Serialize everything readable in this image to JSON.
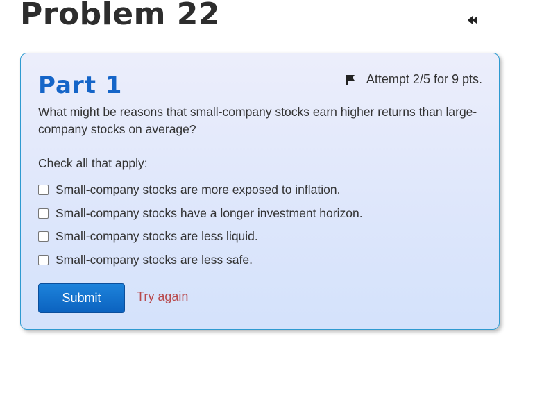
{
  "problem": {
    "title": "Problem 22",
    "collapse_icon": "double-chevron-left-icon"
  },
  "part": {
    "title": "Part 1",
    "attempt_label": "Attempt 2/5 for 9 pts.",
    "flag_icon": "flag-icon",
    "question": "What might be reasons that small-company stocks earn higher returns than large-company stocks on average?",
    "instruction": "Check all that apply:",
    "options": [
      {
        "label": "Small-company stocks are more exposed to inflation.",
        "checked": false
      },
      {
        "label": "Small-company stocks have a longer investment horizon.",
        "checked": false
      },
      {
        "label": "Small-company stocks are less liquid.",
        "checked": false
      },
      {
        "label": "Small-company stocks are less safe.",
        "checked": false
      }
    ],
    "submit_label": "Submit",
    "try_again_label": "Try again"
  },
  "colors": {
    "part_title": "#1565c8",
    "card_border": "#2e9ad0",
    "submit_button": "#0b62bf",
    "try_again": "#b8484b"
  }
}
